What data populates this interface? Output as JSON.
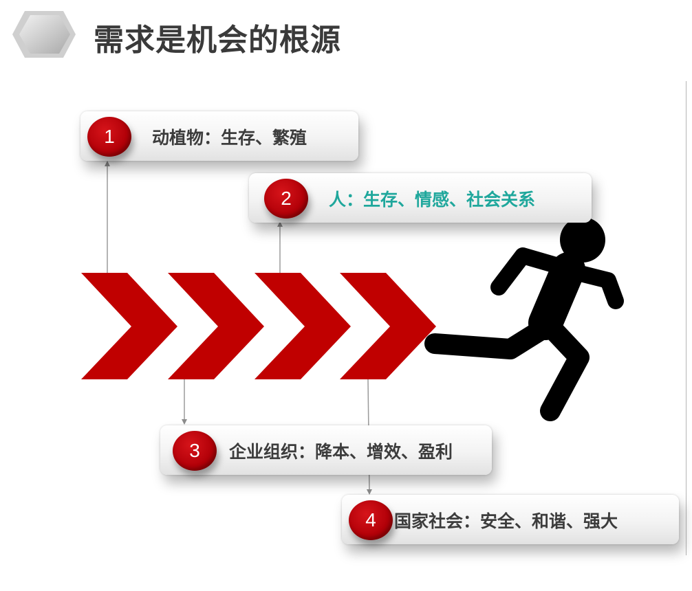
{
  "title": "需求是机会的根源",
  "colors": {
    "accent_red": "#c00000",
    "teal": "#1fa79c",
    "text_dark": "#3c3c3c"
  },
  "steps": [
    {
      "number": "1",
      "text": "动植物：生存、繁殖"
    },
    {
      "number": "2",
      "text": "人：生存、情感、社会关系"
    },
    {
      "number": "3",
      "text": "企业组织：降本、增效、盈利"
    },
    {
      "number": "4",
      "text": "国家社会：安全、和谐、强大"
    }
  ],
  "icons": [
    "diamond-icon",
    "chevron-arrow-icon",
    "running-person-icon"
  ]
}
